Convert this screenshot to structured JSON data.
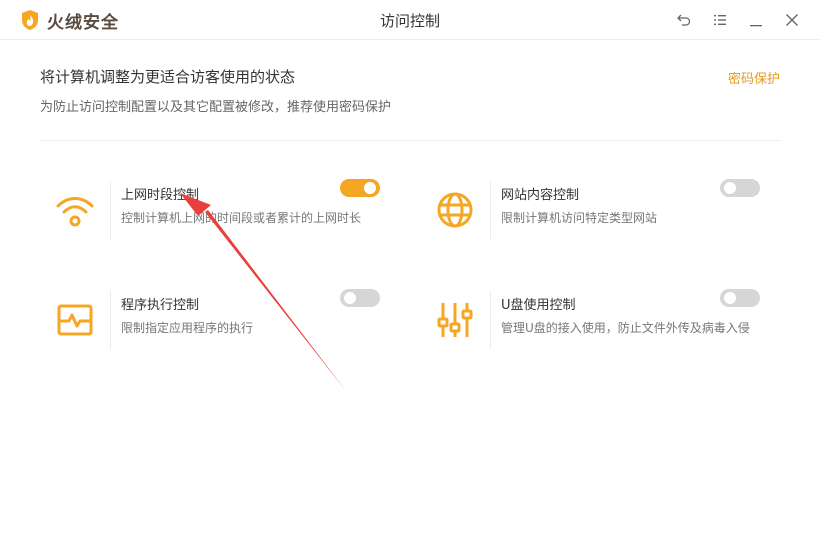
{
  "app": {
    "brand": "火绒安全",
    "window_title": "访问控制"
  },
  "header": {
    "heading": "将计算机调整为更适合访客使用的状态",
    "subheading": "为防止访问控制配置以及其它配置被修改，推荐使用密码保护",
    "password_link": "密码保护"
  },
  "features": [
    {
      "title": "上网时段控制",
      "desc": "控制计算机上网的时间段或者累计的上网时长",
      "enabled": true,
      "icon": "wifi-icon"
    },
    {
      "title": "网站内容控制",
      "desc": "限制计算机访问特定类型网站",
      "enabled": false,
      "icon": "globe-icon"
    },
    {
      "title": "程序执行控制",
      "desc": "限制指定应用程序的执行",
      "enabled": false,
      "icon": "monitor-pulse-icon"
    },
    {
      "title": "U盘使用控制",
      "desc": "管理U盘的接入使用，防止文件外传及病毒入侵",
      "enabled": false,
      "icon": "sliders-icon"
    }
  ],
  "colors": {
    "accent": "#f5a623",
    "link": "#e69a1c",
    "toggle_off": "#d6d6d6",
    "annotation_arrow": "#e8403c"
  }
}
